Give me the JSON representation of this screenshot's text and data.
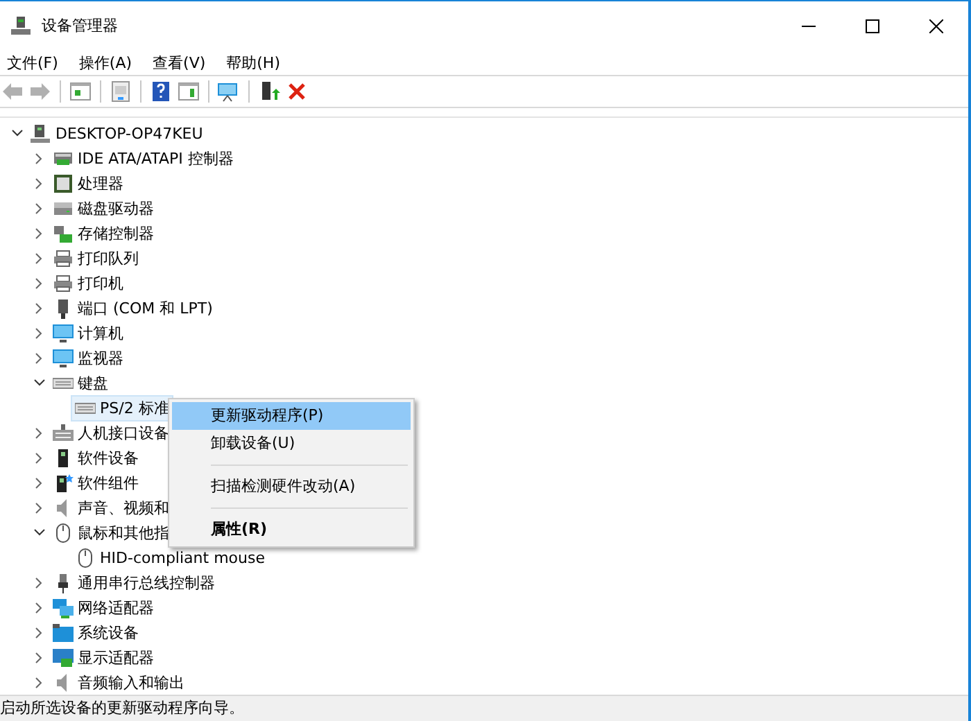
{
  "window": {
    "title": "设备管理器"
  },
  "menu_bar": [
    "文件(F)",
    "操作(A)",
    "查看(V)",
    "帮助(H)"
  ],
  "tree": [
    {
      "label": "DESKTOP-OP47KEU",
      "expanded": true,
      "selected": false,
      "children": [
        {
          "label": "IDE ATA/ATAPI 控制器",
          "expanded": false,
          "selected": false
        },
        {
          "label": "处理器",
          "expanded": false,
          "selected": false
        },
        {
          "label": "磁盘驱动器",
          "expanded": false,
          "selected": false
        },
        {
          "label": "存储控制器",
          "expanded": false,
          "selected": false
        },
        {
          "label": "打印队列",
          "expanded": false,
          "selected": false
        },
        {
          "label": "打印机",
          "expanded": false,
          "selected": false
        },
        {
          "label": "端口 (COM 和 LPT)",
          "expanded": false,
          "selected": false
        },
        {
          "label": "计算机",
          "expanded": false,
          "selected": false
        },
        {
          "label": "监视器",
          "expanded": false,
          "selected": false
        },
        {
          "label": "键盘",
          "expanded": true,
          "selected": false,
          "children": [
            {
              "label": "PS/2 标准",
              "selected": true
            }
          ]
        },
        {
          "label": "人机接口设备",
          "expanded": false,
          "selected": false
        },
        {
          "label": "软件设备",
          "expanded": false,
          "selected": false
        },
        {
          "label": "软件组件",
          "expanded": false,
          "selected": false
        },
        {
          "label": "声音、视频和",
          "expanded": false,
          "selected": false
        },
        {
          "label": "鼠标和其他指",
          "expanded": true,
          "selected": false,
          "children": [
            {
              "label": "HID-compliant mouse",
              "selected": false
            }
          ]
        },
        {
          "label": "通用串行总线控制器",
          "expanded": false,
          "selected": false
        },
        {
          "label": "网络适配器",
          "expanded": false,
          "selected": false
        },
        {
          "label": "系统设备",
          "expanded": false,
          "selected": false
        },
        {
          "label": "显示适配器",
          "expanded": false,
          "selected": false
        },
        {
          "label": "音频输入和输出",
          "expanded": false,
          "selected": false
        }
      ]
    }
  ],
  "context_menu": [
    {
      "kind": "item",
      "label": "更新驱动程序(P)",
      "selected": true,
      "default": false
    },
    {
      "kind": "item",
      "label": "卸载设备(U)",
      "selected": false,
      "default": false
    },
    {
      "kind": "separator"
    },
    {
      "kind": "item",
      "label": "扫描检测硬件改动(A)",
      "selected": false,
      "default": false
    },
    {
      "kind": "separator"
    },
    {
      "kind": "item",
      "label": "属性(R)",
      "selected": false,
      "default": true
    }
  ],
  "status_bar": "启动所选设备的更新驱动程序向导。"
}
